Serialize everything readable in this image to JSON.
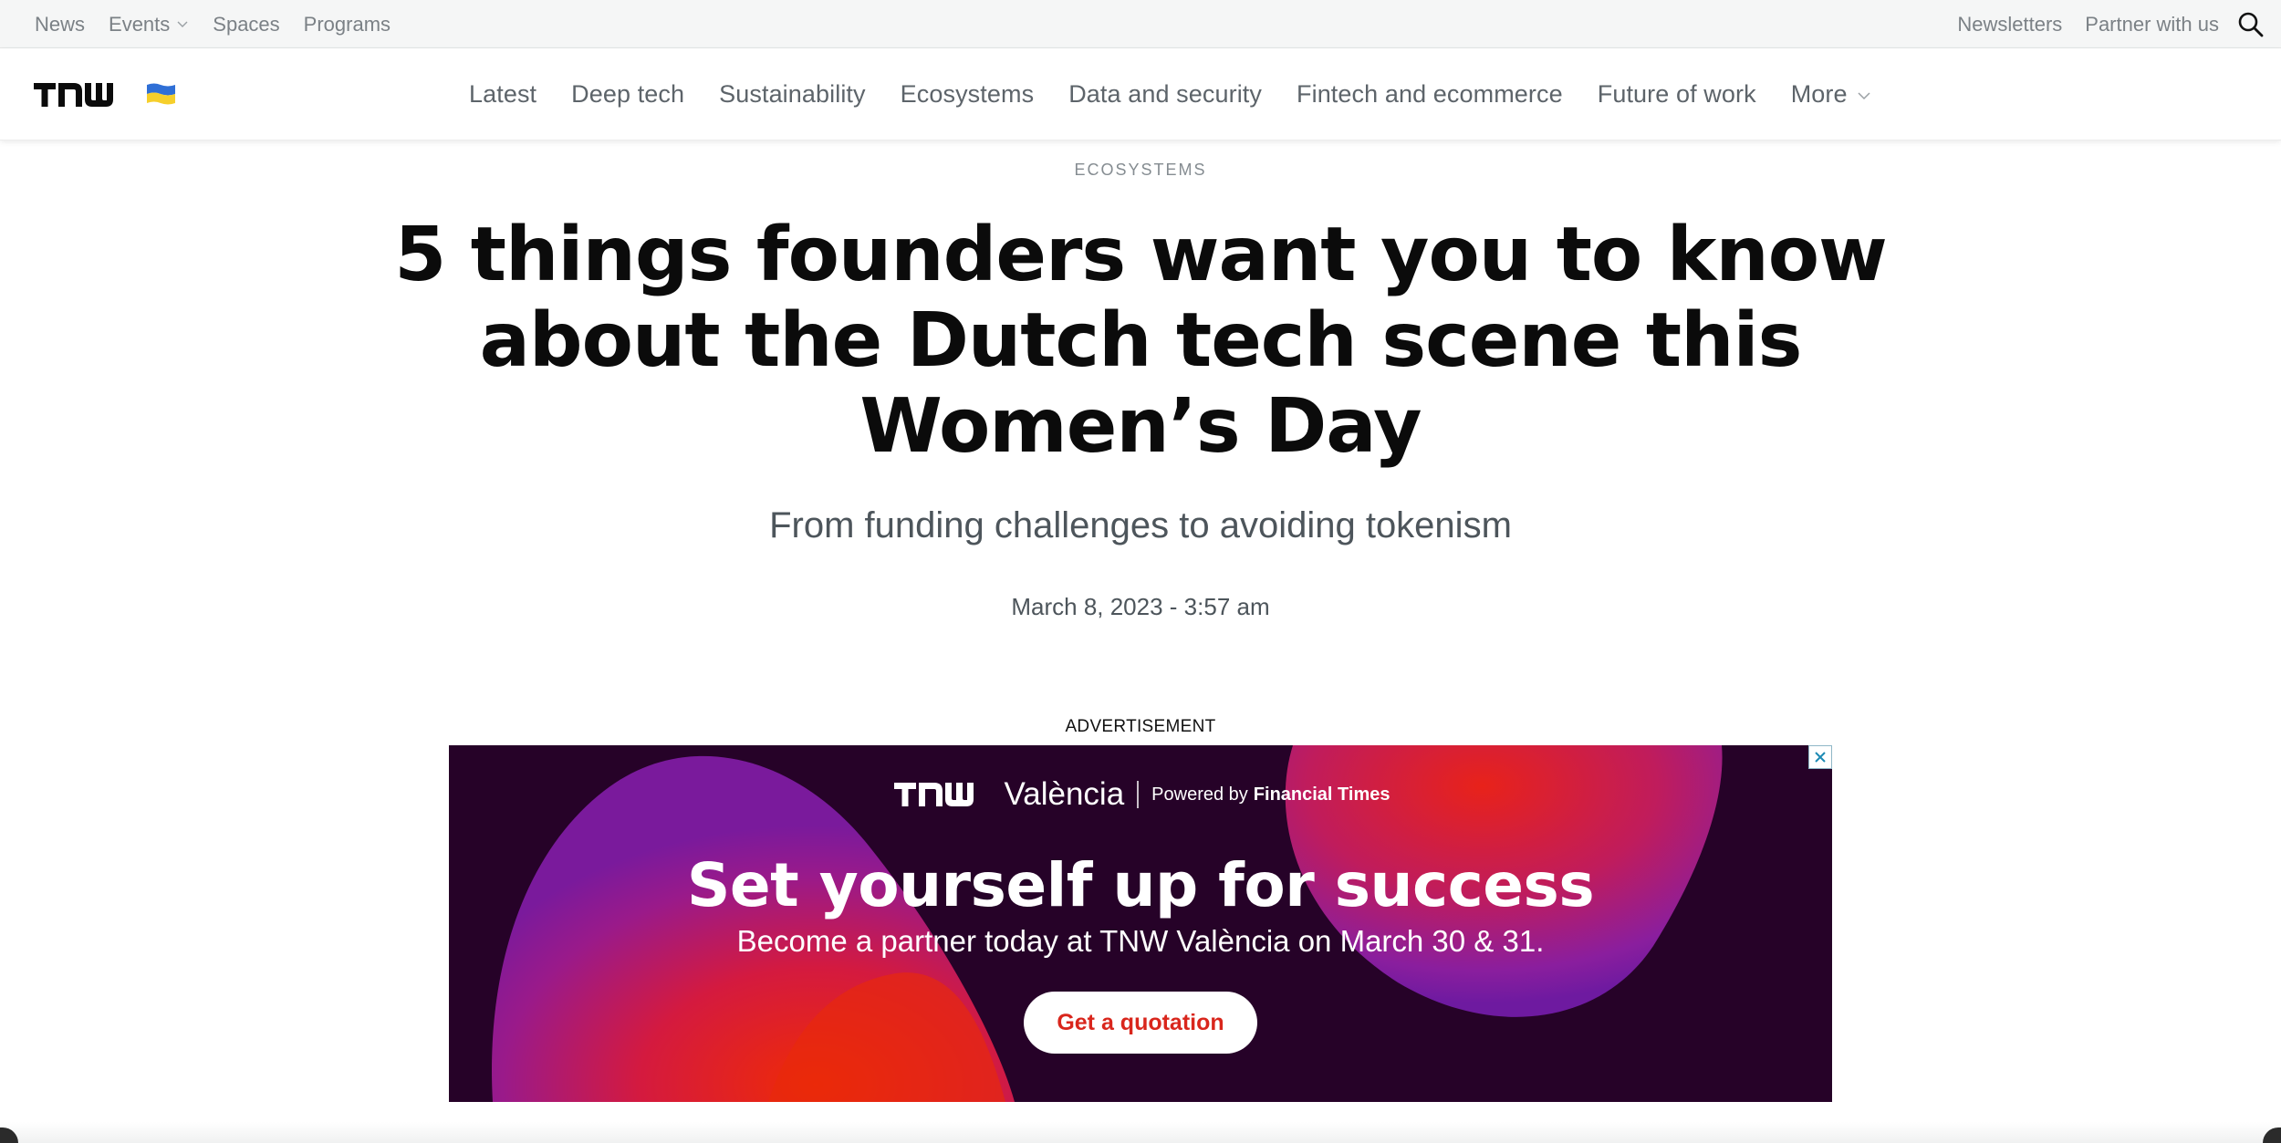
{
  "topbar": {
    "left_links": [
      {
        "label": "News"
      },
      {
        "label": "Events",
        "has_dropdown": true
      },
      {
        "label": "Spaces"
      },
      {
        "label": "Programs"
      }
    ],
    "newsletters": "Newsletters",
    "partner": "Partner with us",
    "search_icon": "search-icon"
  },
  "nav": {
    "logo_text": "TNW",
    "flag_icon": "ukraine-flag-icon",
    "items": [
      {
        "label": "Latest"
      },
      {
        "label": "Deep tech"
      },
      {
        "label": "Sustainability"
      },
      {
        "label": "Ecosystems"
      },
      {
        "label": "Data and security"
      },
      {
        "label": "Fintech and ecommerce"
      },
      {
        "label": "Future of work"
      },
      {
        "label": "More",
        "has_dropdown": true
      }
    ]
  },
  "article": {
    "category": "ECOSYSTEMS",
    "headline": "5 things founders want you to know about the Dutch tech scene this Women’s Day",
    "subheadline": "From funding challenges to avoiding tokenism",
    "date": "March 8, 2023 - 3:57 am"
  },
  "ad": {
    "label": "ADVERTISEMENT",
    "brand_city": "València",
    "powered_by": "Powered by",
    "sponsor": "Financial Times",
    "headline": "Set yourself up for success",
    "subtext": "Become a partner today at TNW València on March 30 & 31.",
    "cta": "Get a quotation"
  },
  "colors": {
    "topbar_bg": "#f5f6f6",
    "nav_text": "#5d646a",
    "ad_bg": "#260228",
    "ad_cta_text": "#d9261c"
  }
}
